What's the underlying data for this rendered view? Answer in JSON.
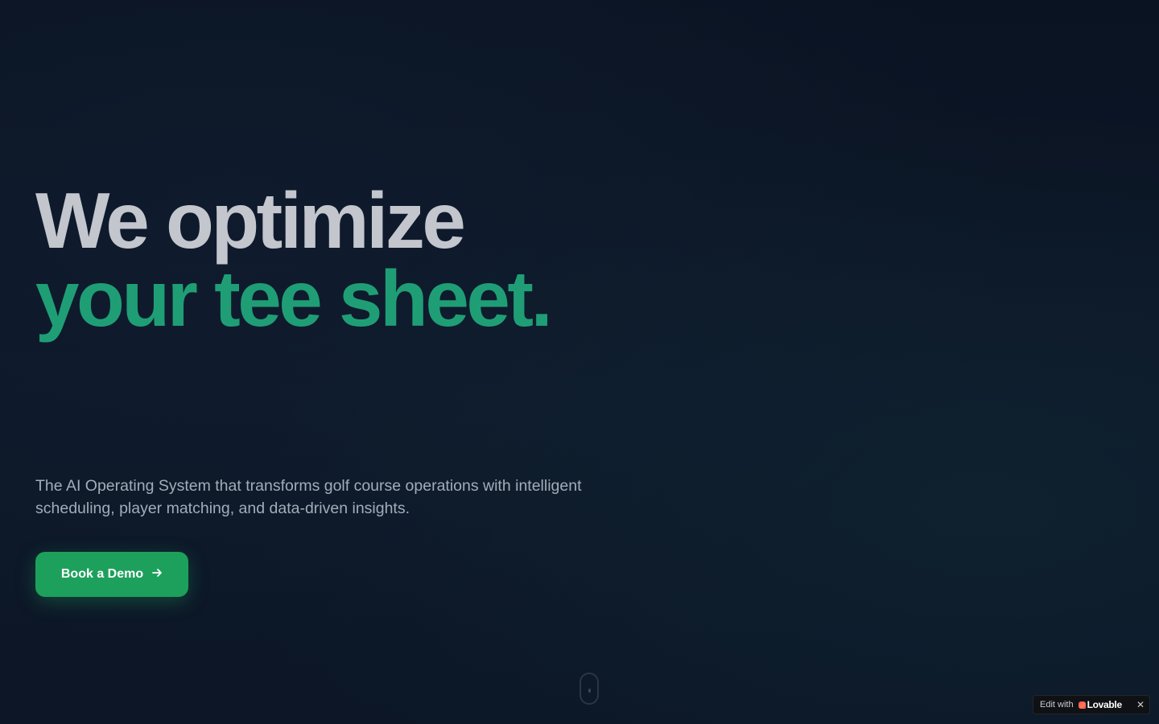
{
  "hero": {
    "headline_line1": "We optimize",
    "headline_line2": "your tee sheet.",
    "subtitle": "The AI Operating System that transforms golf course operations with intelligent scheduling, player matching, and data-driven insights.",
    "cta_label": "Book a Demo",
    "cta_icon": "arrow-right-icon"
  },
  "scroll_indicator": {
    "icon": "mouse-scroll-icon"
  },
  "badge": {
    "prefix": "Edit with",
    "brand": "Lovable",
    "logo_icon": "lovable-heart-icon",
    "close_icon": "close-icon"
  },
  "colors": {
    "background": "#0b1424",
    "headline_primary": "#c3c6cd",
    "headline_accent": "#1f9e76",
    "subtitle": "#a3acb9",
    "cta_background": "#1da05c",
    "cta_text": "#ffffff"
  }
}
